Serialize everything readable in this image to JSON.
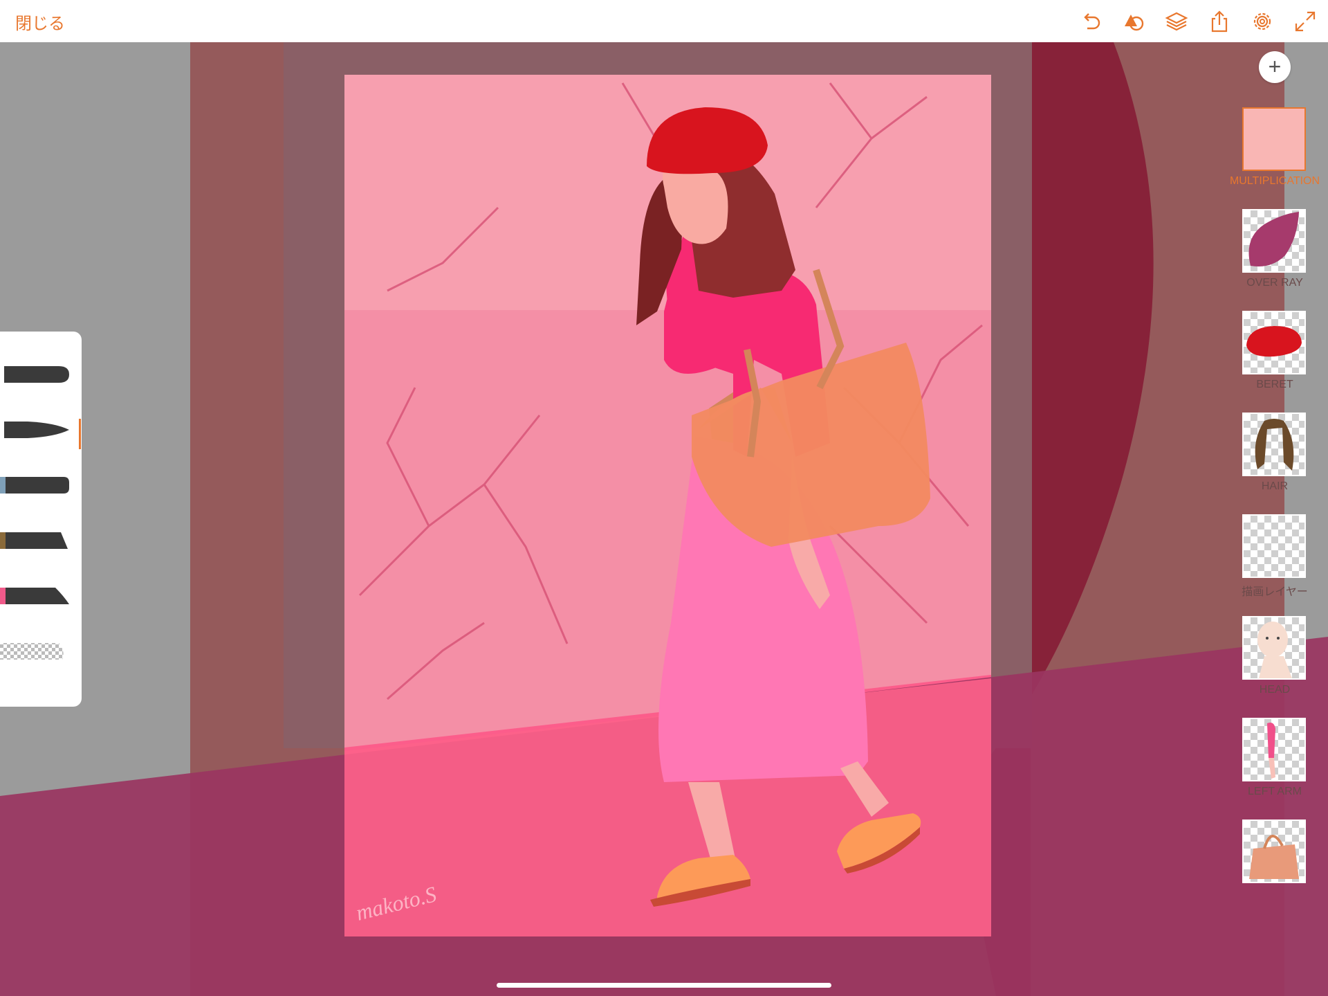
{
  "topbar": {
    "close_label": "閉じる",
    "icons": [
      "undo-icon",
      "shape-icon",
      "layers-icon",
      "share-icon",
      "settings-icon",
      "fullscreen-icon"
    ]
  },
  "colors": {
    "accent": "#e8772e",
    "canvas_bg": "#9b9b9b",
    "panel_bg": "#ffffff"
  },
  "canvas": {
    "signature": "makoto.S"
  },
  "layers_panel": {
    "add_label": "+",
    "items": [
      {
        "label": "MULTIPLICATION",
        "selected": true
      },
      {
        "label": "OVER RAY",
        "selected": false
      },
      {
        "label": "BERET",
        "selected": false
      },
      {
        "label": "HAIR",
        "selected": false
      },
      {
        "label": "描画レイヤー",
        "selected": false
      },
      {
        "label": "HEAD",
        "selected": false
      },
      {
        "label": "LEFT ARM",
        "selected": false
      },
      {
        "label": "",
        "selected": false
      }
    ]
  },
  "brush_tools": {
    "items": [
      "brush-round",
      "brush-pointed",
      "brush-flat",
      "brush-wide",
      "brush-taper",
      "eraser"
    ],
    "selected": "brush-pointed"
  }
}
